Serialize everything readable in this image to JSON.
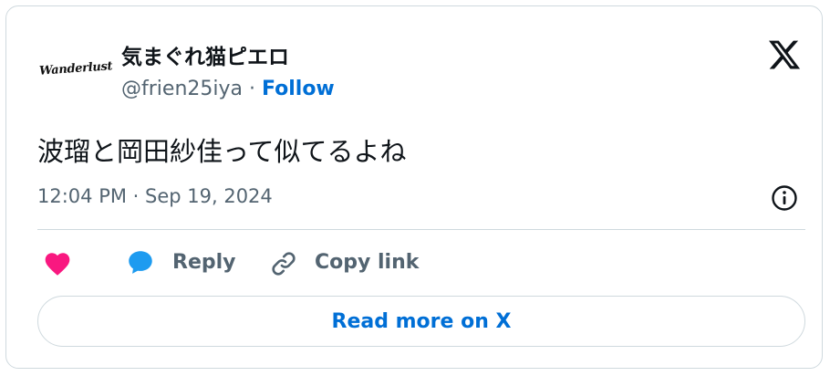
{
  "tweet": {
    "avatar_text": "Wanderlust",
    "display_name": "気まぐれ猫ピエロ",
    "handle": "@frien25iya",
    "separator": " · ",
    "follow_label": "Follow",
    "text": "波瑠と岡田紗佳って似てるよね",
    "timestamp": "12:04 PM · Sep 19, 2024"
  },
  "actions": {
    "reply_label": "Reply",
    "copy_link_label": "Copy link",
    "read_more_label": "Read more on X"
  },
  "icons": {
    "logo": "x-logo-icon",
    "info": "info-icon",
    "like": "heart-icon",
    "reply": "speech-bubble-icon",
    "copy_link": "link-icon"
  },
  "colors": {
    "link_blue": "#006fd6",
    "heart_pink": "#f91880",
    "reply_blue": "#1d9bf0",
    "muted_text": "#536471",
    "primary_text": "#0f1419",
    "border": "#cfd9de"
  }
}
